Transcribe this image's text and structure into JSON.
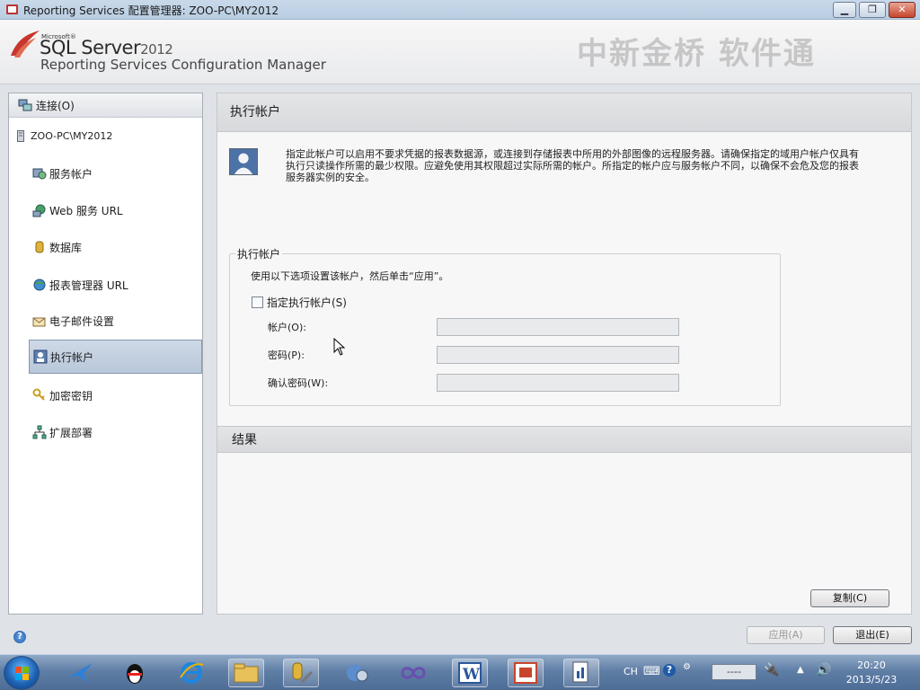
{
  "window": {
    "title": "Reporting Services 配置管理器: ZOO-PC\\MY2012",
    "minimize_label": "▁",
    "maximize_label": "❐",
    "close_label": "✕"
  },
  "banner": {
    "ms": "Microsoft®",
    "product": "SQL Server",
    "year": "2012",
    "subtitle": "Reporting Services Configuration Manager",
    "watermark": "中新金桥 软件通"
  },
  "sidebar": {
    "connect_label": "连接(O)",
    "server": "ZOO-PC\\MY2012",
    "items": [
      {
        "label": "服务帐户",
        "icon": "service-account-icon"
      },
      {
        "label": "Web 服务 URL",
        "icon": "web-service-icon"
      },
      {
        "label": "数据库",
        "icon": "database-icon"
      },
      {
        "label": "报表管理器 URL",
        "icon": "globe-icon"
      },
      {
        "label": "电子邮件设置",
        "icon": "email-icon"
      },
      {
        "label": "执行帐户",
        "icon": "execution-account-icon"
      },
      {
        "label": "加密密钥",
        "icon": "key-icon"
      },
      {
        "label": "扩展部署",
        "icon": "scale-out-icon"
      }
    ],
    "selected_index": 5
  },
  "main": {
    "section_title": "执行帐户",
    "description": "指定此帐户可以启用不要求凭据的报表数据源，或连接到存储报表中所用的外部图像的远程服务器。请确保指定的域用户帐户仅具有执行只读操作所需的最少权限。应避免使用其权限超过实际所需的帐户。所指定的帐户应与服务帐户不同，以确保不会危及您的报表服务器实例的安全。",
    "group_title": "执行帐户",
    "instruction": "使用以下选项设置该帐户，然后单击“应用”。",
    "checkbox_label": "指定执行帐户(S)",
    "checkbox_checked": false,
    "fields": [
      {
        "label": "帐户(O):",
        "value": ""
      },
      {
        "label": "密码(P):",
        "value": ""
      },
      {
        "label": "确认密码(W):",
        "value": ""
      }
    ],
    "results_title": "结果",
    "copy_button": "复制(C)"
  },
  "footer": {
    "help_label": "?",
    "apply_button": "应用(A)",
    "exit_button": "退出(E)"
  },
  "taskbar": {
    "lang": "CH",
    "tray_box": "----",
    "time": "20:20",
    "date": "2013/5/23"
  }
}
